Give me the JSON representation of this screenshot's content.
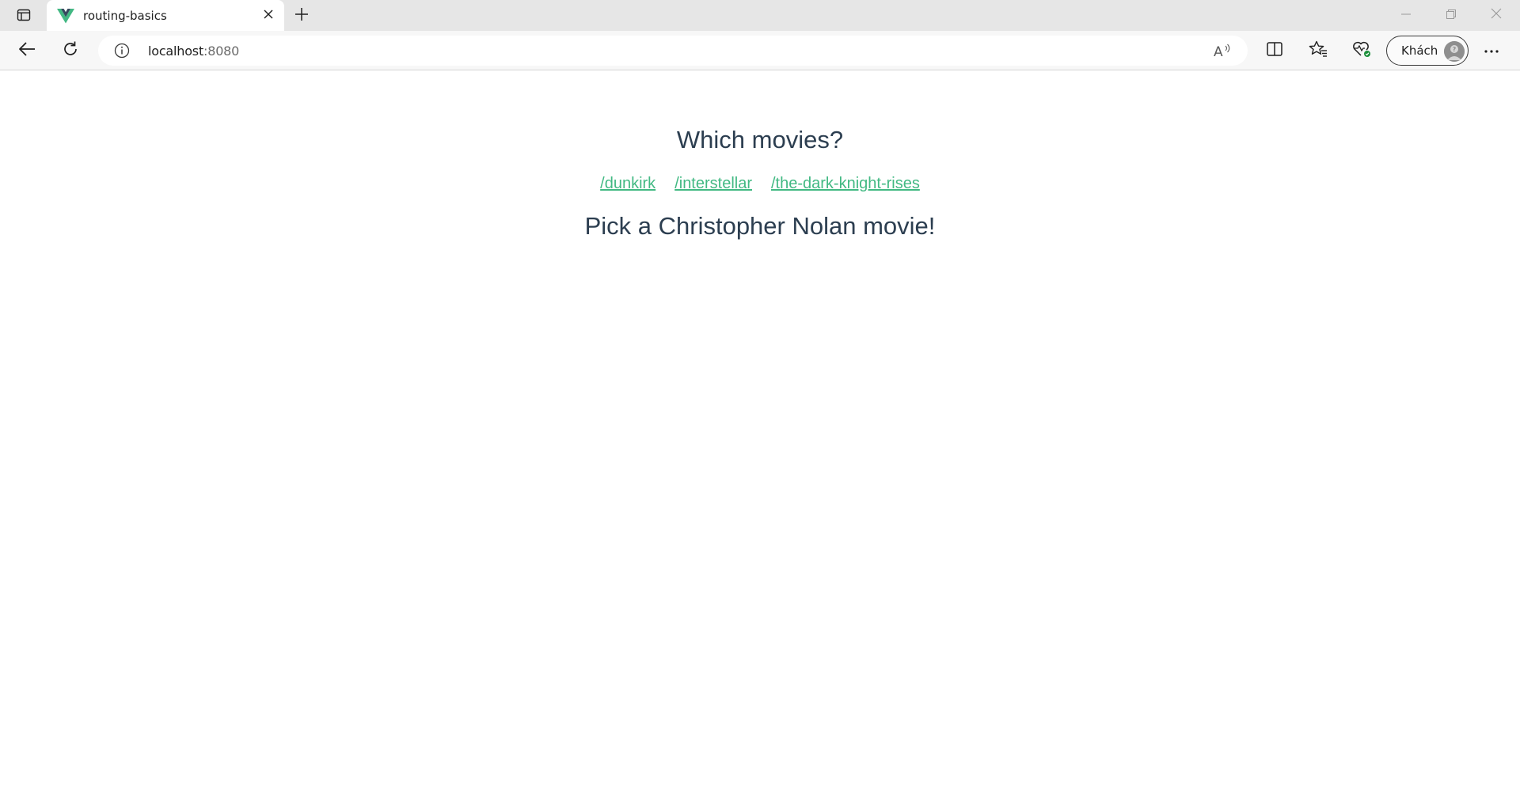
{
  "browser": {
    "tab": {
      "title": "routing-basics",
      "favicon": "vue-logo-icon"
    },
    "address_bar": {
      "host": "localhost",
      "port": ":8080"
    },
    "profile": {
      "label": "Khách"
    },
    "colors": {
      "tabstrip": "#e6e6e6",
      "toolbar": "#f7f7f7",
      "vue_green": "#42b883",
      "vue_dark": "#35495e"
    }
  },
  "page": {
    "title": "Which movies?",
    "links": [
      {
        "label": "/dunkirk"
      },
      {
        "label": "/interstellar"
      },
      {
        "label": "/the-dark-knight-rises"
      }
    ],
    "message": "Pick a Christopher Nolan movie!",
    "colors": {
      "text": "#2c3e50",
      "link": "#42b983"
    }
  }
}
